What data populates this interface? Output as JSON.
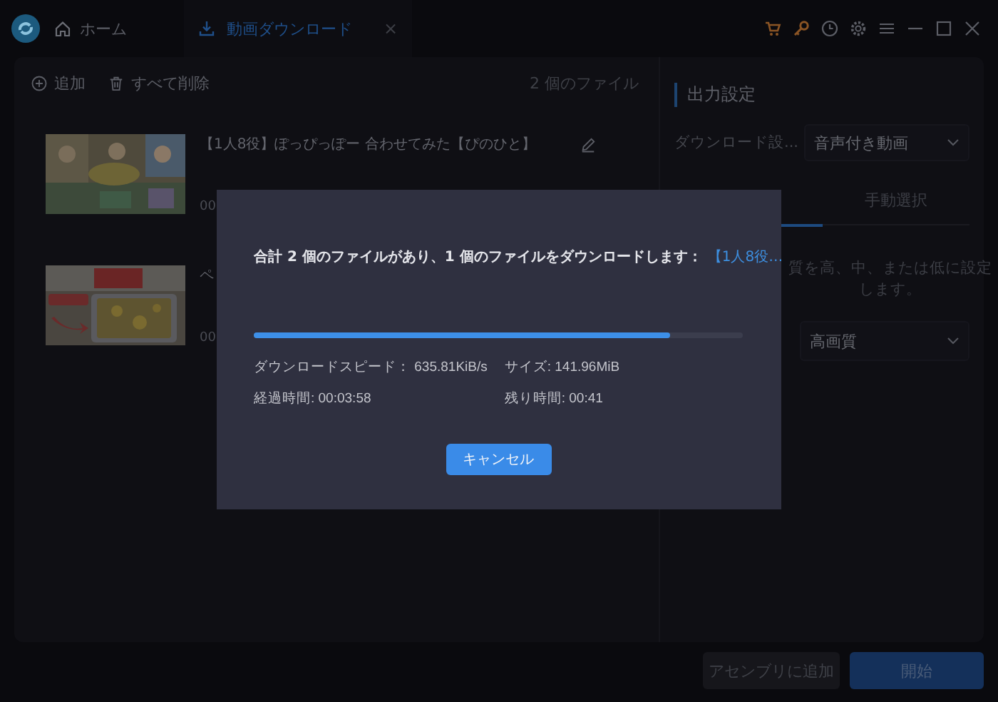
{
  "titlebar": {
    "home_tab": "ホーム",
    "active_tab": "動画ダウンロード",
    "close_tab": "×"
  },
  "toolbar": {
    "add": "追加",
    "delete_all": "すべて削除",
    "file_count": "2 個のファイル"
  },
  "videos": [
    {
      "title": "【1人8役】ぽっぴっぽー 合わせてみた【ぴのひと】",
      "duration": "00",
      "editable": true
    },
    {
      "title": "ペ",
      "duration": "00",
      "editable": false
    }
  ],
  "output": {
    "heading": "出力設定",
    "download_label": "ダウンロード設...",
    "download_value": "音声付き動画",
    "tabs": [
      {
        "selected": true
      },
      {
        "label": "手動選択",
        "selected": false
      }
    ],
    "description": "質を高、中、または低に設定します。",
    "quality_value": "高画質"
  },
  "footer": {
    "buttons": [
      {
        "label": "アセンブリに追加",
        "kind": "secondary",
        "disabled": true
      },
      {
        "label": "開始",
        "kind": "primary",
        "disabled": false
      }
    ]
  },
  "dialog": {
    "message": "合計 2 個のファイルがあり、1 個のファイルをダウンロードします：",
    "link": "【1人8役…",
    "level": 0.85,
    "speed": "ダウンロードスピード： 635.81KiB/s",
    "size": "サイズ: 141.96MiB",
    "elapsed": "経過時間: 00:03:58",
    "remaining": "残り時間: 00:41",
    "cancel": "キャンセル"
  }
}
